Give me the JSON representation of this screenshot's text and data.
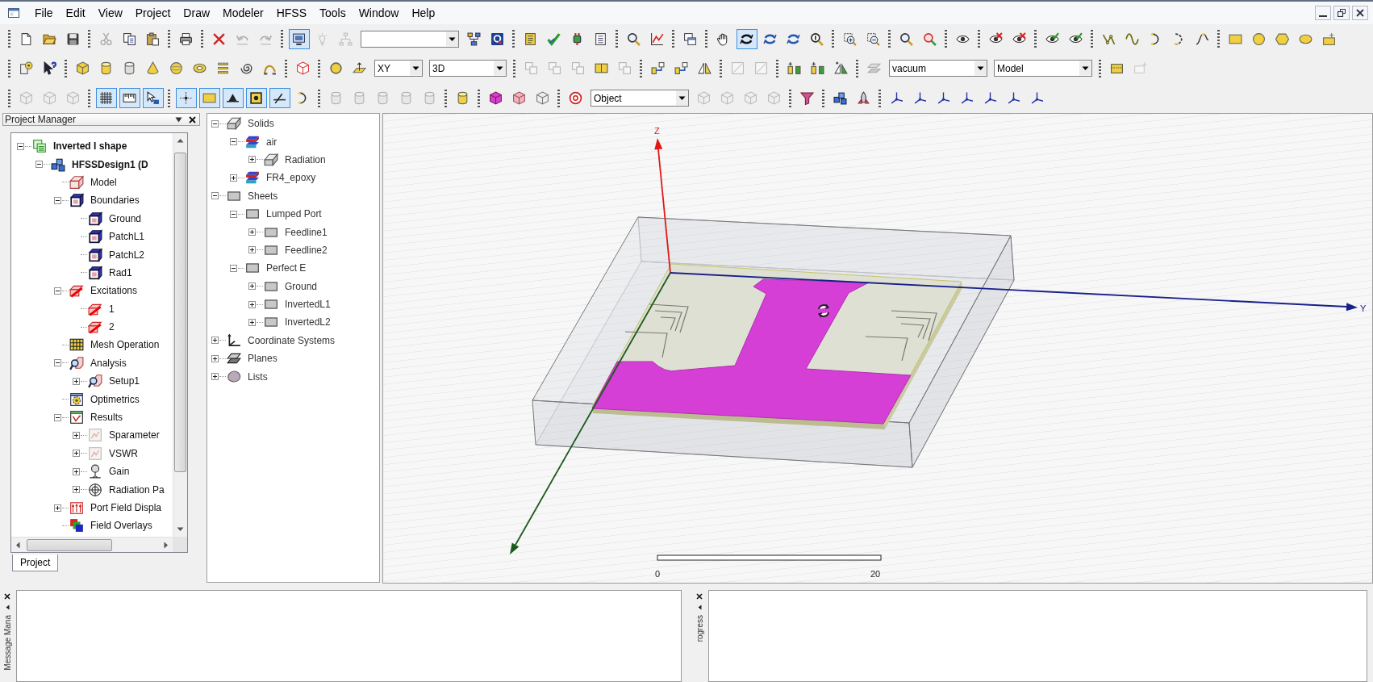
{
  "menu": [
    "File",
    "Edit",
    "View",
    "Project",
    "Draw",
    "Modeler",
    "HFSS",
    "Tools",
    "Window",
    "Help"
  ],
  "toolbars": [
    [
      [
        {
          "kind": "doc",
          "pressed": false,
          "disabled": false
        },
        {
          "kind": "folder",
          "pressed": false,
          "disabled": false
        },
        {
          "kind": "floppy",
          "pressed": false,
          "disabled": false
        }
      ],
      [
        {
          "kind": "scissors",
          "pressed": false,
          "disabled": true
        },
        {
          "kind": "copy",
          "pressed": false,
          "disabled": false
        },
        {
          "kind": "paste",
          "pressed": false,
          "disabled": false
        }
      ],
      [
        {
          "kind": "printer",
          "pressed": false,
          "disabled": false
        }
      ],
      [
        {
          "kind": "cross",
          "pressed": false,
          "disabled": false
        },
        {
          "kind": "undo",
          "pressed": false,
          "disabled": true
        },
        {
          "kind": "redo",
          "pressed": false,
          "disabled": true
        }
      ],
      [
        {
          "kind": "monitor",
          "pressed": true,
          "disabled": false
        },
        {
          "kind": "lamp",
          "pressed": false,
          "disabled": true
        },
        {
          "kind": "treediag",
          "pressed": false,
          "disabled": true
        },
        {
          "kind": "dropdown",
          "disabled": false
        },
        {
          "kind": "connector",
          "pressed": false,
          "disabled": false
        },
        {
          "kind": "qtile",
          "pressed": false,
          "disabled": false
        }
      ],
      [
        {
          "kind": "ysheet",
          "pressed": false,
          "disabled": false
        },
        {
          "kind": "check",
          "pressed": false,
          "disabled": false
        },
        {
          "kind": "plug",
          "pressed": false,
          "disabled": false
        },
        {
          "kind": "listdoc",
          "pressed": false,
          "disabled": false
        }
      ],
      [
        {
          "kind": "magnifier",
          "pressed": false,
          "disabled": false
        },
        {
          "kind": "linechart",
          "pressed": false,
          "disabled": false
        }
      ],
      [
        {
          "kind": "windows",
          "pressed": false,
          "disabled": false
        }
      ],
      [
        {
          "kind": "hand",
          "pressed": false,
          "disabled": false
        },
        {
          "kind": "rotate",
          "pressed": true,
          "disabled": false
        },
        {
          "kind": "rotate2",
          "pressed": false,
          "disabled": false
        },
        {
          "kind": "rotate2",
          "pressed": false,
          "disabled": false
        },
        {
          "kind": "zoomone",
          "pressed": false,
          "disabled": false
        }
      ],
      [
        {
          "kind": "zoomin",
          "pressed": false,
          "disabled": false
        },
        {
          "kind": "zoomout",
          "pressed": false,
          "disabled": false
        }
      ],
      [
        {
          "kind": "magnifier",
          "pressed": false,
          "disabled": false
        },
        {
          "kind": "magred",
          "pressed": false,
          "disabled": false
        }
      ],
      [
        {
          "kind": "eye",
          "pressed": false,
          "disabled": false
        }
      ],
      [
        {
          "kind": "eyecross",
          "pressed": false,
          "disabled": false
        },
        {
          "kind": "eyecross",
          "pressed": false,
          "disabled": false
        }
      ],
      [
        {
          "kind": "eyecheck",
          "pressed": false,
          "disabled": false
        },
        {
          "kind": "eyecheck",
          "pressed": false,
          "disabled": false
        }
      ],
      [
        {
          "kind": "polyline",
          "pressed": false,
          "disabled": false
        },
        {
          "kind": "spline",
          "pressed": false,
          "disabled": false
        },
        {
          "kind": "arc",
          "pressed": false,
          "disabled": false
        },
        {
          "kind": "arc2",
          "pressed": false,
          "disabled": false
        },
        {
          "kind": "curve",
          "pressed": false,
          "disabled": false
        }
      ],
      [
        {
          "kind": "rect",
          "pressed": false,
          "disabled": false
        },
        {
          "kind": "circle",
          "pressed": false,
          "disabled": false
        },
        {
          "kind": "hexagon",
          "pressed": false,
          "disabled": false
        },
        {
          "kind": "ellipse",
          "pressed": false,
          "disabled": false
        },
        {
          "kind": "region",
          "pressed": false,
          "disabled": false
        }
      ]
    ],
    [
      [
        {
          "kind": "helppage",
          "pressed": false,
          "disabled": false
        },
        {
          "kind": "pointerq",
          "pressed": false,
          "disabled": false
        }
      ],
      [
        {
          "kind": "cube",
          "pressed": false,
          "disabled": false
        },
        {
          "kind": "cylinder",
          "pressed": false,
          "disabled": false
        },
        {
          "kind": "cylinder-b",
          "pressed": false,
          "disabled": false
        },
        {
          "kind": "cone",
          "pressed": false,
          "disabled": false
        },
        {
          "kind": "sphere",
          "pressed": false,
          "disabled": false
        },
        {
          "kind": "torus",
          "pressed": false,
          "disabled": false
        },
        {
          "kind": "helix",
          "pressed": false,
          "disabled": false
        },
        {
          "kind": "spiral",
          "pressed": false,
          "disabled": false
        },
        {
          "kind": "bondwire",
          "pressed": false,
          "disabled": false
        }
      ],
      [
        {
          "kind": "cubeoutline",
          "pressed": false,
          "disabled": false
        }
      ],
      [
        {
          "kind": "point",
          "pressed": false,
          "disabled": false
        },
        {
          "kind": "plane",
          "pressed": false,
          "disabled": false
        },
        {
          "kind": "dropdown",
          "value": "XY",
          "disabled": false
        },
        {
          "kind": "dropdown",
          "value": "3D",
          "disabled": false
        }
      ],
      [
        {
          "kind": "squares",
          "pressed": false,
          "disabled": true
        },
        {
          "kind": "squares",
          "pressed": false,
          "disabled": true
        },
        {
          "kind": "squares",
          "pressed": false,
          "disabled": true
        },
        {
          "kind": "split",
          "pressed": false,
          "disabled": false
        },
        {
          "kind": "squares",
          "pressed": false,
          "disabled": true
        }
      ],
      [
        {
          "kind": "arrange",
          "pressed": false,
          "disabled": false
        },
        {
          "kind": "arrange",
          "pressed": false,
          "disabled": false
        },
        {
          "kind": "mirror",
          "pressed": false,
          "disabled": false
        }
      ],
      [
        {
          "kind": "frame",
          "pressed": false,
          "disabled": true
        },
        {
          "kind": "frame",
          "pressed": false,
          "disabled": true
        }
      ],
      [
        {
          "kind": "dupline",
          "pressed": false,
          "disabled": false
        },
        {
          "kind": "dupline",
          "pressed": false,
          "disabled": false
        },
        {
          "kind": "dupmirror",
          "pressed": false,
          "disabled": false
        }
      ],
      [
        {
          "kind": "sheets",
          "pressed": false,
          "disabled": true
        },
        {
          "kind": "dropdown",
          "value": "vacuum",
          "disabled": false
        },
        {
          "kind": "dropdown",
          "value": "Model",
          "disabled": false
        }
      ],
      [
        {
          "kind": "sheetyellow",
          "pressed": false,
          "disabled": false
        },
        {
          "kind": "sheetplus",
          "pressed": false,
          "disabled": true
        }
      ]
    ],
    [
      [
        {
          "kind": "cube-d",
          "pressed": false,
          "disabled": true
        },
        {
          "kind": "cube-d",
          "pressed": false,
          "disabled": true
        },
        {
          "kind": "cube-d",
          "pressed": false,
          "disabled": true
        }
      ],
      [
        {
          "kind": "grid",
          "pressed": true,
          "disabled": false
        },
        {
          "kind": "ruler",
          "pressed": true,
          "disabled": false
        },
        {
          "kind": "handptr",
          "pressed": true,
          "disabled": false
        }
      ],
      [
        {
          "kind": "snapgrid",
          "pressed": true,
          "disabled": false
        },
        {
          "kind": "rect",
          "pressed": true,
          "disabled": false
        },
        {
          "kind": "snapedge",
          "pressed": true,
          "disabled": false
        },
        {
          "kind": "snapcenter",
          "pressed": true,
          "disabled": false
        },
        {
          "kind": "snapline",
          "pressed": true,
          "disabled": false
        },
        {
          "kind": "arc",
          "pressed": false,
          "disabled": false
        }
      ],
      [
        {
          "kind": "cylinder-b",
          "pressed": false,
          "disabled": true
        },
        {
          "kind": "cylinder-b",
          "pressed": false,
          "disabled": true
        },
        {
          "kind": "cylinder-b",
          "pressed": false,
          "disabled": true
        },
        {
          "kind": "cylinder-b",
          "pressed": false,
          "disabled": true
        },
        {
          "kind": "cylinder-b",
          "pressed": false,
          "disabled": true
        }
      ],
      [
        {
          "kind": "cylinder",
          "pressed": false,
          "disabled": false
        }
      ],
      [
        {
          "kind": "cube-b",
          "pressed": false,
          "disabled": false
        },
        {
          "kind": "cube-c",
          "pressed": false,
          "disabled": false
        },
        {
          "kind": "cube-d",
          "pressed": false,
          "disabled": false
        }
      ],
      [
        {
          "kind": "ring",
          "pressed": false,
          "disabled": false
        },
        {
          "kind": "dropdown",
          "value": "Object",
          "disabled": false
        },
        {
          "kind": "cube-d",
          "pressed": false,
          "disabled": true
        },
        {
          "kind": "cube-d",
          "pressed": false,
          "disabled": true
        },
        {
          "kind": "cube-d",
          "pressed": false,
          "disabled": true
        },
        {
          "kind": "cube-d",
          "pressed": false,
          "disabled": true
        }
      ],
      [
        {
          "kind": "funnel",
          "pressed": false,
          "disabled": false
        }
      ],
      [
        {
          "kind": "cubes",
          "pressed": false,
          "disabled": false
        },
        {
          "kind": "rocket",
          "pressed": false,
          "disabled": false
        }
      ],
      [
        {
          "kind": "axes",
          "pressed": false,
          "disabled": false
        },
        {
          "kind": "axes",
          "pressed": false,
          "disabled": false
        },
        {
          "kind": "axes",
          "pressed": false,
          "disabled": false
        },
        {
          "kind": "axes",
          "pressed": false,
          "disabled": false
        },
        {
          "kind": "axes",
          "pressed": false,
          "disabled": false
        },
        {
          "kind": "axes",
          "pressed": false,
          "disabled": false
        },
        {
          "kind": "axes",
          "pressed": false,
          "disabled": false
        }
      ]
    ]
  ],
  "project_manager": {
    "title": "Project Manager",
    "tree": [
      {
        "label": "Inverted I shape",
        "kind": "project",
        "expanded": true,
        "children": [
          {
            "label": "HFSSDesign1 (D",
            "kind": "design",
            "expanded": true,
            "children": [
              {
                "label": "Model",
                "kind": "model"
              },
              {
                "label": "Boundaries",
                "kind": "boundary",
                "expanded": true,
                "children": [
                  {
                    "label": "Ground",
                    "kind": "boundary"
                  },
                  {
                    "label": "PatchL1",
                    "kind": "boundary"
                  },
                  {
                    "label": "PatchL2",
                    "kind": "boundary"
                  },
                  {
                    "label": "Rad1",
                    "kind": "boundary"
                  }
                ]
              },
              {
                "label": "Excitations",
                "kind": "excitation",
                "expanded": true,
                "children": [
                  {
                    "label": "1",
                    "kind": "excitation"
                  },
                  {
                    "label": "2",
                    "kind": "excitation"
                  }
                ]
              },
              {
                "label": "Mesh Operation",
                "kind": "mesh"
              },
              {
                "label": "Analysis",
                "kind": "analysis",
                "expanded": true,
                "children": [
                  {
                    "label": "Setup1",
                    "kind": "analysis",
                    "expanded": false
                  }
                ]
              },
              {
                "label": "Optimetrics",
                "kind": "optimetrics"
              },
              {
                "label": "Results",
                "kind": "results",
                "expanded": true,
                "children": [
                  {
                    "label": "Sparameter",
                    "kind": "report",
                    "expanded": false
                  },
                  {
                    "label": "VSWR",
                    "kind": "report",
                    "expanded": false
                  },
                  {
                    "label": "Gain",
                    "kind": "gain",
                    "expanded": false
                  },
                  {
                    "label": "Radiation Pa",
                    "kind": "radiation",
                    "expanded": false
                  }
                ]
              },
              {
                "label": "Port Field Displa",
                "kind": "portfield",
                "expanded": false
              },
              {
                "label": "Field Overlays",
                "kind": "overlays"
              }
            ]
          }
        ]
      }
    ],
    "tabs": [
      {
        "label": "Project",
        "selected": true
      }
    ]
  },
  "model_tree": [
    {
      "label": "Solids",
      "kind": "solids",
      "expanded": true,
      "children": [
        {
          "label": "air",
          "kind": "material",
          "expanded": true,
          "children": [
            {
              "label": "Radiation",
              "kind": "solids",
              "expanded": false
            }
          ]
        },
        {
          "label": "FR4_epoxy",
          "kind": "material",
          "expanded": false
        }
      ]
    },
    {
      "label": "Sheets",
      "kind": "sheet",
      "expanded": true,
      "children": [
        {
          "label": "Lumped Port",
          "kind": "sheet",
          "expanded": true,
          "children": [
            {
              "label": "Feedline1",
              "kind": "sheet",
              "expanded": false
            },
            {
              "label": "Feedline2",
              "kind": "sheet",
              "expanded": false
            }
          ]
        },
        {
          "label": "Perfect E",
          "kind": "sheet",
          "expanded": true,
          "children": [
            {
              "label": "Ground",
              "kind": "sheet",
              "expanded": false
            },
            {
              "label": "InvertedL1",
              "kind": "sheet",
              "expanded": false
            },
            {
              "label": "InvertedL2",
              "kind": "sheet",
              "expanded": false
            }
          ]
        }
      ]
    },
    {
      "label": "Coordinate Systems",
      "kind": "coords",
      "expanded": false
    },
    {
      "label": "Planes",
      "kind": "planes",
      "expanded": false
    },
    {
      "label": "Lists",
      "kind": "lists",
      "expanded": false
    }
  ],
  "viewport": {
    "axes": [
      {
        "kind": "z",
        "label": "Z"
      },
      {
        "kind": "y",
        "label": "Y"
      },
      {
        "kind": "x"
      }
    ],
    "scale_labels": [
      "0",
      "20"
    ]
  },
  "bottom_panels": [
    {
      "title": "Message Mana"
    },
    {
      "title": "rogress"
    }
  ]
}
